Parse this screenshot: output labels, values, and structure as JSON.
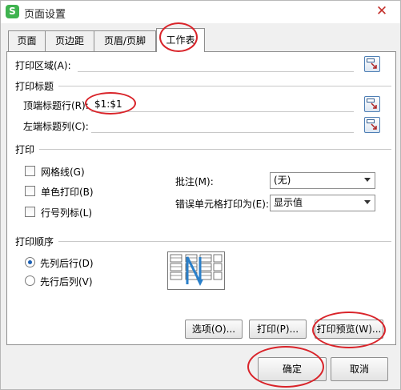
{
  "window": {
    "title": "页面设置",
    "app_icon_glyph": "S",
    "close_glyph": "✕"
  },
  "tabs": [
    {
      "label": "页面"
    },
    {
      "label": "页边距"
    },
    {
      "label": "页眉/页脚"
    },
    {
      "label": "工作表"
    }
  ],
  "print_area": {
    "label": "打印区域(A):",
    "value": ""
  },
  "print_titles": {
    "section": "打印标题",
    "rows_label": "顶端标题行(R):",
    "rows_value": "$1:$1",
    "cols_label": "左端标题列(C):",
    "cols_value": ""
  },
  "print": {
    "section": "打印",
    "gridlines": "网格线(G)",
    "mono": "单色打印(B)",
    "row_col_headers": "行号列标(L)",
    "comments_label": "批注(M):",
    "comments_value": "(无)",
    "errors_label": "错误单元格打印为(E):",
    "errors_value": "显示值"
  },
  "page_order": {
    "section": "打印顺序",
    "down_then_over": "先列后行(D)",
    "over_then_down": "先行后列(V)",
    "selected": "down_then_over"
  },
  "buttons": {
    "options": "选项(O)...",
    "print": "打印(P)...",
    "preview": "打印预览(W)...",
    "ok": "确定",
    "cancel": "取消"
  },
  "colors": {
    "annotation": "#d9242a",
    "accent": "#1a5fb4"
  }
}
